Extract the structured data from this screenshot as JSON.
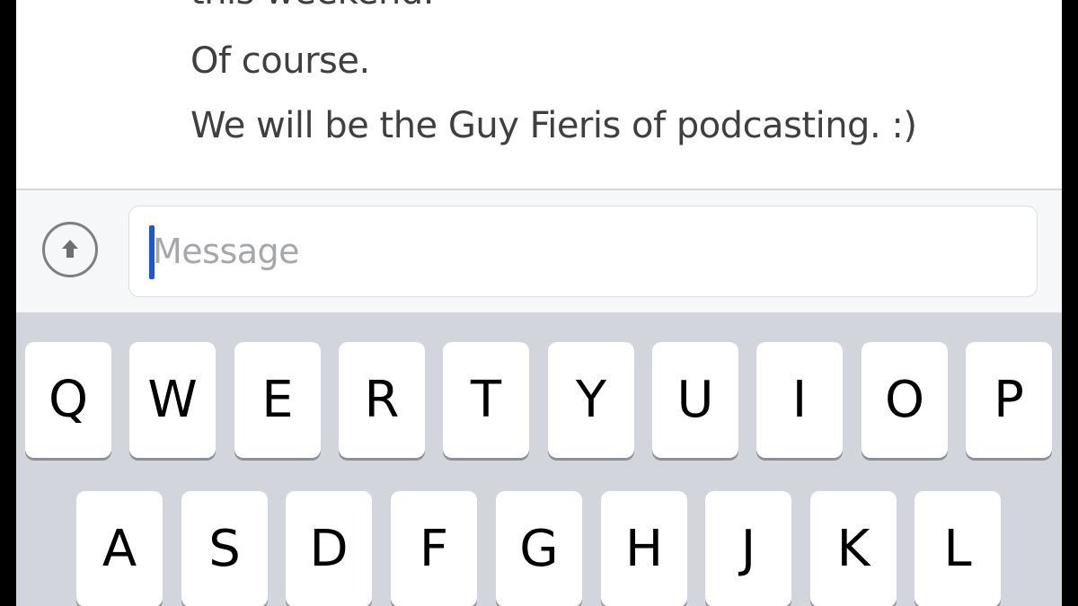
{
  "messages": [
    "this weekend.",
    "Of course.",
    "We will be the Guy Fieris of podcasting. :)"
  ],
  "composer": {
    "placeholder": "Message",
    "upload_icon": "upload-arrow-icon",
    "cursor_color": "#1c56e0"
  },
  "keyboard": {
    "row1": [
      "Q",
      "W",
      "E",
      "R",
      "T",
      "Y",
      "U",
      "I",
      "O",
      "P"
    ],
    "row2": [
      "A",
      "S",
      "D",
      "F",
      "G",
      "H",
      "J",
      "K",
      "L"
    ]
  },
  "colors": {
    "keyboard_bg": "#d2d5db",
    "key_bg": "#ffffff",
    "message_text": "#3f3f3f",
    "placeholder": "#a5a7aa"
  }
}
